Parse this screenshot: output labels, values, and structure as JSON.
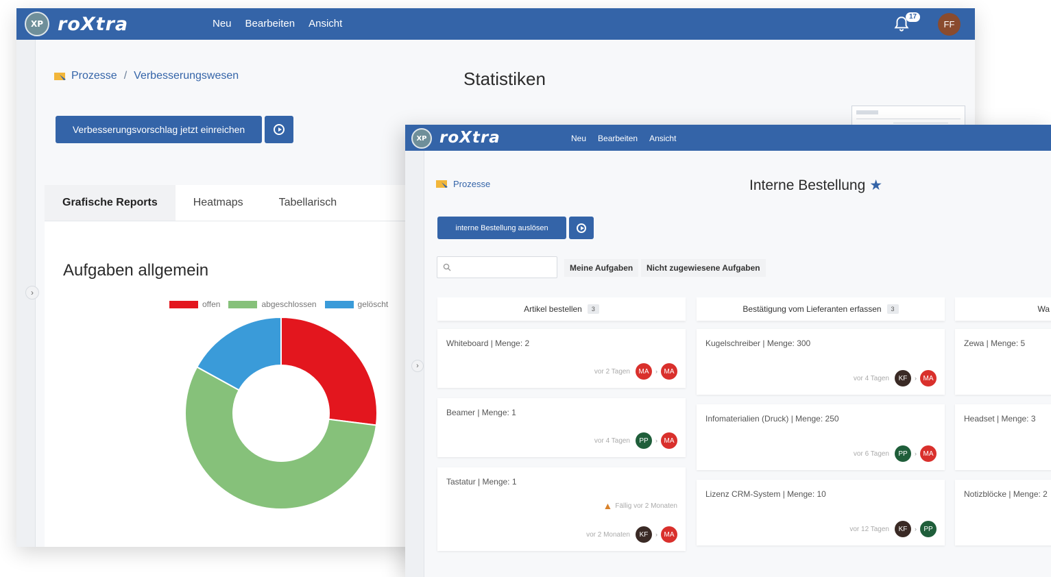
{
  "app": {
    "logo_badge": "XP",
    "logo_text": "roXtra",
    "nav": [
      "Neu",
      "Bearbeiten",
      "Ansicht"
    ],
    "notification_count": "17",
    "user_initials": "FF",
    "brand_color": "#3464a8"
  },
  "stats_window": {
    "breadcrumb": [
      "Prozesse",
      "Verbesserungswesen"
    ],
    "title": "Statistiken",
    "primary_button": "Verbesserungsvorschlag jetzt einreichen",
    "tabs": [
      "Grafische Reports",
      "Heatmaps",
      "Tabellarisch"
    ],
    "active_tab": "Grafische Reports",
    "report_title": "Aufgaben allgemein"
  },
  "chart_data": {
    "type": "pie",
    "title": "Aufgaben allgemein",
    "categories": [
      "offen",
      "abgeschlossen",
      "gelöscht"
    ],
    "values": [
      27,
      56,
      17
    ],
    "colors": [
      "#e3161e",
      "#86c17a",
      "#3a9bd9"
    ],
    "donut": true,
    "legend": "top"
  },
  "order_window": {
    "breadcrumb": "Prozesse",
    "title": "Interne Bestellung",
    "primary_button": "interne Bestellung auslösen",
    "filters": [
      "Meine Aufgaben",
      "Nicht zugewiesene Aufgaben"
    ],
    "columns": [
      {
        "title": "Artikel bestellen",
        "count": "3",
        "cards": [
          {
            "title": "Whiteboard | Menge: 2",
            "age": "vor 2 Tagen",
            "from": "MA",
            "to": "MA"
          },
          {
            "title": "Beamer | Menge: 1",
            "age": "vor 4 Tagen",
            "from": "PP",
            "to": "MA"
          },
          {
            "title": "Tastatur | Menge: 1",
            "due": "Fällig vor 2 Monaten",
            "age": "vor 2 Monaten",
            "from": "KF",
            "to": "MA"
          }
        ]
      },
      {
        "title": "Bestätigung vom Lieferanten erfassen",
        "count": "3",
        "cards": [
          {
            "title": "Kugelschreiber | Menge: 300",
            "age": "vor 4 Tagen",
            "from": "KF",
            "to": "MA"
          },
          {
            "title": "Infomaterialien (Druck) | Menge: 250",
            "age": "vor 6 Tagen",
            "from": "PP",
            "to": "MA"
          },
          {
            "title": "Lizenz CRM-System | Menge: 10",
            "age": "vor 12 Tagen",
            "from": "KF",
            "to": "PP"
          }
        ]
      },
      {
        "title": "Wa",
        "cards": [
          {
            "title": "Zewa | Menge: 5"
          },
          {
            "title": "Headset | Menge: 3"
          },
          {
            "title": "Notizblöcke | Menge: 2"
          }
        ]
      }
    ]
  }
}
